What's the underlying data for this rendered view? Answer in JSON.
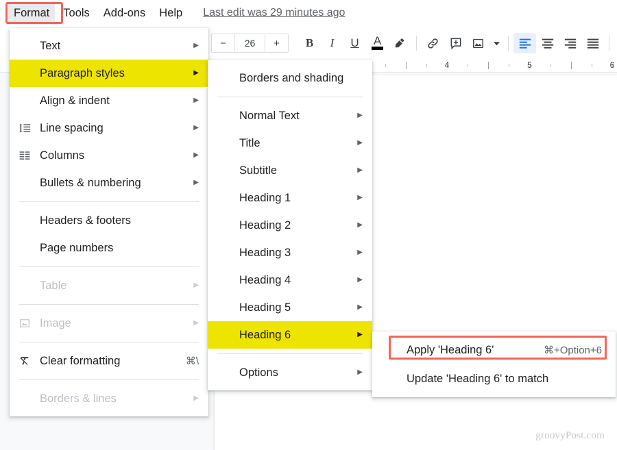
{
  "menubar": {
    "items": [
      {
        "label": "Format",
        "active": true
      },
      {
        "label": "Tools",
        "active": false
      },
      {
        "label": "Add-ons",
        "active": false
      },
      {
        "label": "Help",
        "active": false
      }
    ],
    "last_edit": "Last edit was 29 minutes ago"
  },
  "toolbar": {
    "font_size": "26",
    "decrease_label": "−",
    "increase_label": "+",
    "bold_label": "B",
    "italic_label": "I",
    "underline_label": "U",
    "text_color_label": "A",
    "highlight_icon": "highlighter-icon",
    "link_icon": "link-icon",
    "comment_icon": "add-comment-icon",
    "image_icon": "insert-image-icon",
    "image_dropdown_icon": "chevron-down-icon",
    "align_left_icon": "align-left-icon",
    "align_center_icon": "align-center-icon",
    "align_right_icon": "align-right-icon",
    "align_justify_icon": "align-justify-icon",
    "active_alignment": "align-left"
  },
  "ruler": {
    "labels": [
      "4",
      "5",
      "6"
    ]
  },
  "format_menu": {
    "items": [
      {
        "label": "Text",
        "icon": "",
        "arrow": true,
        "disabled": false,
        "highlighted": false,
        "accel": ""
      },
      {
        "label": "Paragraph styles",
        "icon": "",
        "arrow": true,
        "disabled": false,
        "highlighted": true,
        "accel": ""
      },
      {
        "label": "Align & indent",
        "icon": "",
        "arrow": true,
        "disabled": false,
        "highlighted": false,
        "accel": ""
      },
      {
        "label": "Line spacing",
        "icon": "line-spacing-icon",
        "arrow": true,
        "disabled": false,
        "highlighted": false,
        "accel": ""
      },
      {
        "label": "Columns",
        "icon": "columns-icon",
        "arrow": true,
        "disabled": false,
        "highlighted": false,
        "accel": ""
      },
      {
        "label": "Bullets & numbering",
        "icon": "",
        "arrow": true,
        "disabled": false,
        "highlighted": false,
        "accel": ""
      },
      {
        "separator": true
      },
      {
        "label": "Headers & footers",
        "icon": "",
        "arrow": false,
        "disabled": false,
        "highlighted": false,
        "accel": ""
      },
      {
        "label": "Page numbers",
        "icon": "",
        "arrow": false,
        "disabled": false,
        "highlighted": false,
        "accel": ""
      },
      {
        "separator": true
      },
      {
        "label": "Table",
        "icon": "",
        "arrow": true,
        "disabled": true,
        "highlighted": false,
        "accel": ""
      },
      {
        "separator": true
      },
      {
        "label": "Image",
        "icon": "image-icon",
        "arrow": true,
        "disabled": true,
        "highlighted": false,
        "accel": ""
      },
      {
        "separator": true
      },
      {
        "label": "Clear formatting",
        "icon": "clear-formatting-icon",
        "arrow": false,
        "disabled": false,
        "highlighted": false,
        "accel": "⌘\\"
      },
      {
        "separator": true
      },
      {
        "label": "Borders & lines",
        "icon": "",
        "arrow": true,
        "disabled": true,
        "highlighted": false,
        "accel": ""
      }
    ]
  },
  "paragraph_styles_menu": {
    "items": [
      {
        "label": "Borders and shading",
        "arrow": false,
        "highlighted": false
      },
      {
        "separator": true
      },
      {
        "label": "Normal Text",
        "arrow": true,
        "highlighted": false
      },
      {
        "label": "Title",
        "arrow": true,
        "highlighted": false
      },
      {
        "label": "Subtitle",
        "arrow": true,
        "highlighted": false
      },
      {
        "label": "Heading 1",
        "arrow": true,
        "highlighted": false
      },
      {
        "label": "Heading 2",
        "arrow": true,
        "highlighted": false
      },
      {
        "label": "Heading 3",
        "arrow": true,
        "highlighted": false
      },
      {
        "label": "Heading 4",
        "arrow": true,
        "highlighted": false
      },
      {
        "label": "Heading 5",
        "arrow": true,
        "highlighted": false
      },
      {
        "label": "Heading 6",
        "arrow": true,
        "highlighted": true
      },
      {
        "separator": true
      },
      {
        "label": "Options",
        "arrow": true,
        "highlighted": false
      }
    ]
  },
  "heading6_menu": {
    "items": [
      {
        "label": "Apply 'Heading 6'",
        "accel": "⌘+Option+6",
        "annotated": true
      },
      {
        "label": "Update 'Heading 6' to match",
        "accel": "",
        "annotated": false
      }
    ]
  },
  "watermark": "groovyPost.com",
  "colors": {
    "highlight_yellow": "#ede400",
    "annotation_red": "#f4645a",
    "accent_blue": "#1a73e8",
    "menu_active_bg": "#e8eaed"
  }
}
